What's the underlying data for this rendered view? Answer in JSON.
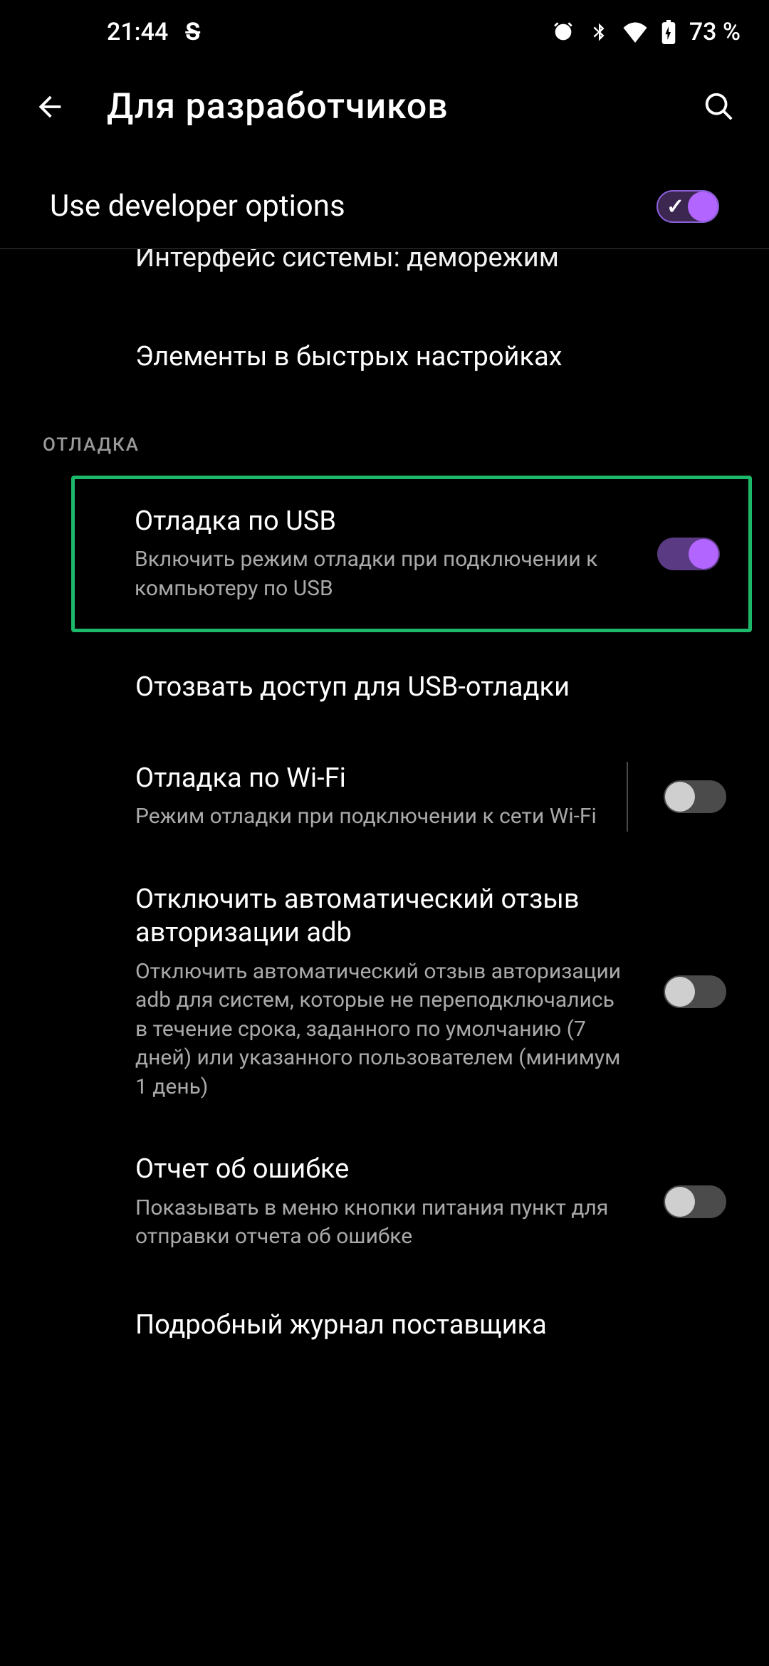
{
  "statusbar": {
    "time": "21:44",
    "s_indicator": "S",
    "battery_text": "73 %"
  },
  "appbar": {
    "title": "Для разработчиков"
  },
  "master": {
    "label": "Use developer options",
    "enabled": true
  },
  "truncated_top": "Интерфейс системы: деморежим",
  "sections": [
    {
      "items": [
        {
          "title": "Элементы в быстрых настройках"
        }
      ]
    },
    {
      "label": "ОТЛАДКА",
      "items": [
        {
          "title": "Отладка по USB",
          "sub": "Включить режим отладки при подключении к компьютеру по USB",
          "switch": "on",
          "highlighted": true
        },
        {
          "title": "Отозвать доступ для USB-отладки"
        },
        {
          "title": "Отладка по Wi-Fi",
          "sub": "Режим отладки при подключении к сети Wi-Fi",
          "switch": "off",
          "vdivider": true
        },
        {
          "title": "Отключить автоматический отзыв авторизации adb",
          "sub": "Отключить автоматический отзыв авторизации adb для систем, которые не переподключались в течение срока, заданного по умолчанию (7 дней) или указанного пользователем (минимум 1 день)",
          "switch": "off"
        },
        {
          "title": "Отчет об ошибке",
          "sub": "Показывать в меню кнопки питания пункт для отправки отчета об ошибке",
          "switch": "off"
        },
        {
          "title": "Подробный журнал поставщика"
        }
      ]
    }
  ]
}
